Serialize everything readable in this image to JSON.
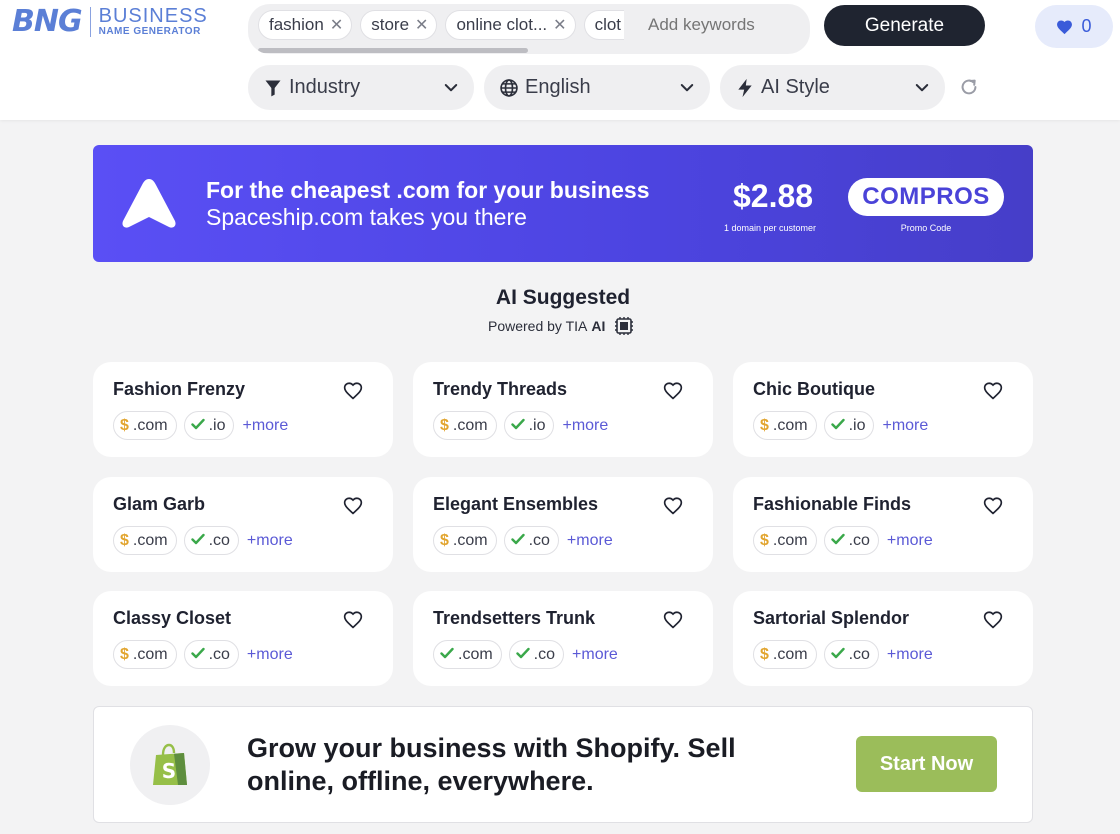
{
  "logo": {
    "mark": "BNG",
    "line1": "BUSINESS",
    "line2": "NAME GENERATOR"
  },
  "keywords": {
    "chips": [
      "fashion",
      "store",
      "online clot...",
      "clot"
    ],
    "placeholder": "Add keywords"
  },
  "generate_label": "Generate",
  "favorites_count": "0",
  "filters": {
    "industry": "Industry",
    "language": "English",
    "ai_style": "AI Style"
  },
  "promo": {
    "headline": "For the cheapest .com for your business",
    "subline": "Spaceship.com takes you there",
    "price": "$2.88",
    "price_caption": "1 domain per customer",
    "code": "COMPROS",
    "code_caption": "Promo Code"
  },
  "section": {
    "title": "AI Suggested",
    "powered_by": "Powered by TIA",
    "ai_label": "AI"
  },
  "more_label": "+more",
  "suggestions": [
    {
      "name": "Fashion Frenzy",
      "ext1": ".com",
      "ext1_status": "dollar",
      "ext2": ".io",
      "ext2_status": "check"
    },
    {
      "name": "Trendy Threads",
      "ext1": ".com",
      "ext1_status": "dollar",
      "ext2": ".io",
      "ext2_status": "check"
    },
    {
      "name": "Chic Boutique",
      "ext1": ".com",
      "ext1_status": "dollar",
      "ext2": ".io",
      "ext2_status": "check"
    },
    {
      "name": "Glam Garb",
      "ext1": ".com",
      "ext1_status": "dollar",
      "ext2": ".co",
      "ext2_status": "check"
    },
    {
      "name": "Elegant Ensembles",
      "ext1": ".com",
      "ext1_status": "dollar",
      "ext2": ".co",
      "ext2_status": "check"
    },
    {
      "name": "Fashionable Finds",
      "ext1": ".com",
      "ext1_status": "dollar",
      "ext2": ".co",
      "ext2_status": "check"
    },
    {
      "name": "Classy Closet",
      "ext1": ".com",
      "ext1_status": "dollar",
      "ext2": ".co",
      "ext2_status": "check"
    },
    {
      "name": "Trendsetters Trunk",
      "ext1": ".com",
      "ext1_status": "check",
      "ext2": ".co",
      "ext2_status": "check"
    },
    {
      "name": "Sartorial Splendor",
      "ext1": ".com",
      "ext1_status": "dollar",
      "ext2": ".co",
      "ext2_status": "check"
    }
  ],
  "shopify": {
    "headline": "Grow your business with Shopify. Sell online, offline, everywhere.",
    "cta": "Start Now"
  },
  "colors": {
    "accent": "#5a4ff5",
    "dark_button": "#1f2430",
    "shopify_green": "#9bbd5a",
    "more_link": "#5b5ad6",
    "dollar": "#e2a52f",
    "check": "#3aa84a"
  }
}
